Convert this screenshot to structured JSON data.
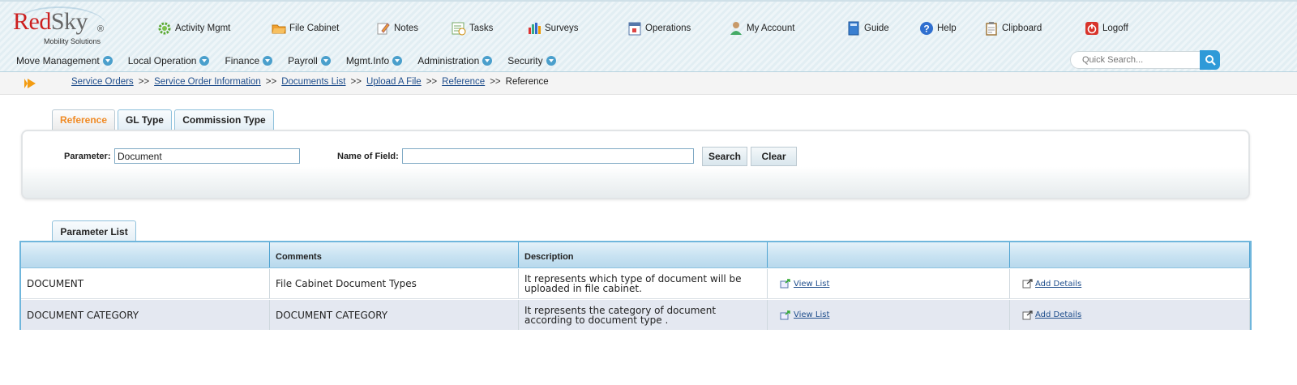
{
  "logo": {
    "red": "Red",
    "gray": "Sky",
    "reg": "®",
    "sub": "Mobility Solutions"
  },
  "topnav": [
    {
      "label": "Activity Mgmt",
      "icon": "gear-icon"
    },
    {
      "label": "File Cabinet",
      "icon": "folder-icon"
    },
    {
      "label": "Notes",
      "icon": "pencil-icon"
    },
    {
      "label": "Tasks",
      "icon": "tasks-icon"
    },
    {
      "label": "Surveys",
      "icon": "bar-chart-icon"
    },
    {
      "label": "Operations",
      "icon": "calendar-icon"
    },
    {
      "label": "My Account",
      "icon": "user-icon"
    },
    {
      "label": "Guide",
      "icon": "book-icon"
    },
    {
      "label": "Help",
      "icon": "help-icon"
    },
    {
      "label": "Clipboard",
      "icon": "clipboard-icon"
    },
    {
      "label": "Logoff",
      "icon": "power-icon"
    }
  ],
  "menu": [
    {
      "label": "Move Management"
    },
    {
      "label": "Local Operation"
    },
    {
      "label": "Finance"
    },
    {
      "label": "Payroll"
    },
    {
      "label": "Mgmt.Info"
    },
    {
      "label": "Administration"
    },
    {
      "label": "Security"
    }
  ],
  "quick_search": {
    "placeholder": "Quick Search..."
  },
  "breadcrumb": {
    "links": [
      "Service Orders",
      "Service Order Information",
      "Documents List",
      "Upload A File",
      "Reference"
    ],
    "separator": ">>",
    "current": "Reference"
  },
  "tabs": [
    {
      "label": "Reference",
      "active": true
    },
    {
      "label": "GL Type",
      "active": false
    },
    {
      "label": "Commission Type",
      "active": false
    }
  ],
  "search_form": {
    "parameter_label": "Parameter:",
    "parameter_value": "Document",
    "field_label": "Name of Field:",
    "field_value": "",
    "search_button": "Search",
    "clear_button": "Clear"
  },
  "parameter_list": {
    "tab_label": "Parameter List",
    "columns": [
      "",
      "Comments",
      "Description",
      "",
      ""
    ],
    "rows": [
      {
        "name": "DOCUMENT",
        "comments": "File Cabinet Document Types",
        "description_line1": "It represents which type of document will be",
        "description_line2": "uploaded in file cabinet.",
        "view": "View List",
        "add": "Add Details"
      },
      {
        "name": "DOCUMENT CATEGORY",
        "comments": "DOCUMENT CATEGORY",
        "description_line1": "It represents the category of document",
        "description_line2": "according to document type .",
        "view": "View List",
        "add": "Add Details"
      }
    ]
  },
  "colors": {
    "accent": "#2f9ad8",
    "active_tab": "#f08a24",
    "link": "#1f4e8c",
    "logo_red": "#cc1f1f"
  }
}
